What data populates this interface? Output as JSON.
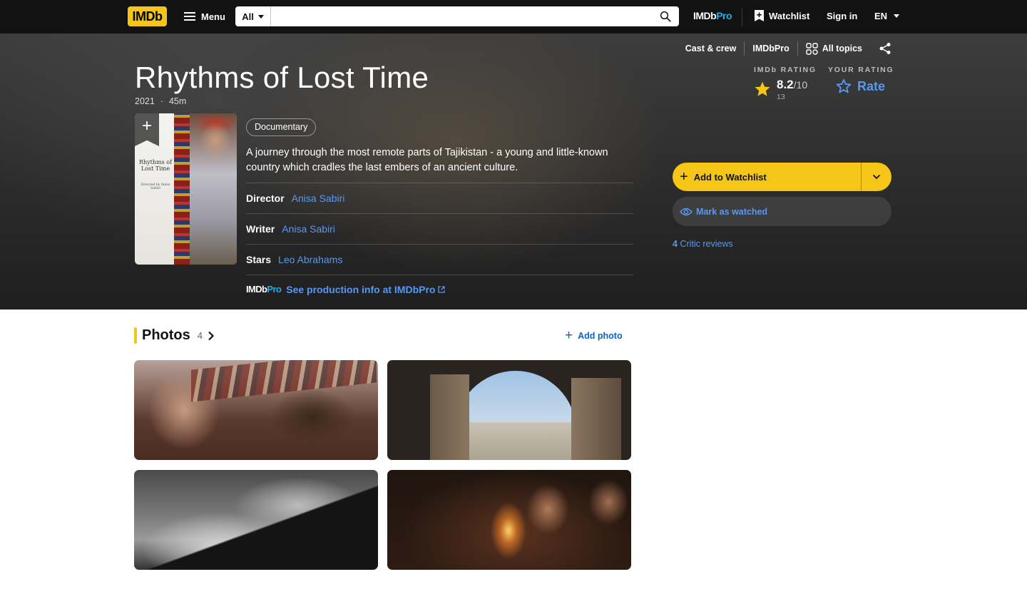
{
  "nav": {
    "logo": "IMDb",
    "menu_label": "Menu",
    "search_category": "All",
    "search_placeholder": "",
    "pro_a": "IMDb",
    "pro_b": "Pro",
    "watchlist_label": "Watchlist",
    "signin_label": "Sign in",
    "language": "EN"
  },
  "subnav": {
    "links": [
      "Cast & crew",
      "IMDbPro",
      "All topics"
    ]
  },
  "movie": {
    "title": "Rhythms of Lost Time",
    "year": "2021",
    "separator": "·",
    "runtime": "45m",
    "genre": "Documentary",
    "plot": "A journey through the most remote parts of Tajikistan - a young and little-known country which cradles the last embers of an ancient culture.",
    "poster_title": "Rhythms of Lost Time",
    "poster_credit": "Directed by Anisa Sabiri"
  },
  "rating": {
    "imdb_label": "IMDb RATING",
    "score": "8.2",
    "out_of": "/10",
    "count": "13",
    "your_label": "YOUR RATING",
    "rate_label": "Rate"
  },
  "credits": [
    {
      "label": "Director",
      "value": "Anisa Sabiri"
    },
    {
      "label": "Writer",
      "value": "Anisa Sabiri"
    },
    {
      "label": "Stars",
      "value": "Leo Abrahams"
    }
  ],
  "production": {
    "pro_a": "IMDb",
    "pro_b": "Pro",
    "link_label": "See production info at IMDbPro"
  },
  "actions": {
    "add_watchlist": "Add to Watchlist",
    "mark_watched": "Mark as watched",
    "critic_count": "4",
    "critic_label": "Critic reviews"
  },
  "photos": {
    "title": "Photos",
    "count": "4",
    "add_label": "Add photo"
  },
  "colors": {
    "brand_yellow": "#f5c518",
    "link_blue": "#5799ef",
    "pro_blue": "#1eb0e6",
    "dark": "#121212"
  }
}
